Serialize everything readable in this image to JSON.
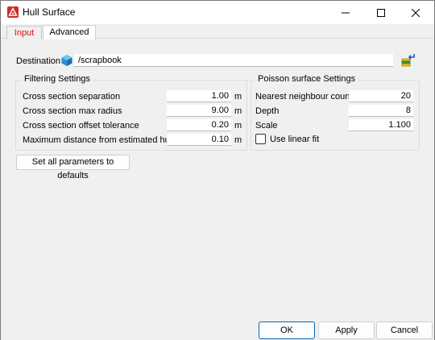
{
  "window": {
    "title": "Hull Surface"
  },
  "tabs": [
    {
      "label": "Input",
      "color": "#e01010"
    },
    {
      "label": "Advanced"
    }
  ],
  "destination": {
    "label": "Destination",
    "value": "/scrapbook",
    "icon": "cube-icon"
  },
  "filtering": {
    "title": "Filtering Settings",
    "rows": [
      {
        "label": "Cross section separation",
        "value": "1.00",
        "unit": "m"
      },
      {
        "label": "Cross section max radius",
        "value": "9.00",
        "unit": "m"
      },
      {
        "label": "Cross section offset tolerance",
        "value": "0.20",
        "unit": "m"
      },
      {
        "label": "Maximum distance from estimated hull",
        "value": "0.10",
        "unit": "m"
      }
    ]
  },
  "poisson": {
    "title": "Poisson surface Settings",
    "rows": [
      {
        "label": "Nearest neighbour count",
        "value": "20"
      },
      {
        "label": "Depth",
        "value": "8"
      },
      {
        "label": "Scale",
        "value": "1.100"
      }
    ],
    "linear_fit_label": "Use linear fit",
    "linear_fit_checked": false
  },
  "defaults_button": "Set all parameters to defaults",
  "footer": {
    "ok": "OK",
    "apply": "Apply",
    "cancel": "Cancel"
  },
  "colors": {
    "accent": "#0067c0",
    "app_icon": "#d12b2b"
  }
}
